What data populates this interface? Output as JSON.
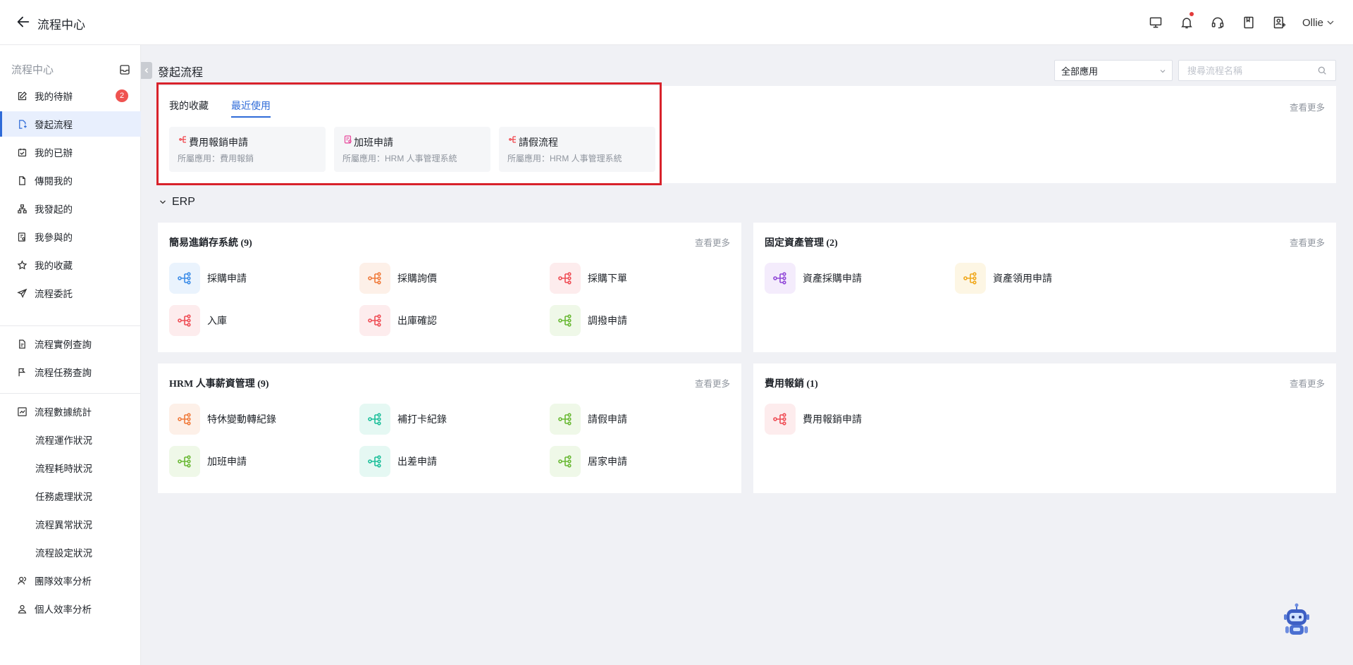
{
  "header": {
    "title": "流程中心",
    "user": "Ollie",
    "icons": [
      "monitor-icon",
      "bell-icon",
      "headset-icon",
      "book-icon",
      "user-card-icon"
    ]
  },
  "sidebar": {
    "title": "流程中心",
    "items": [
      {
        "label": "我的待辦",
        "badge": "2"
      },
      {
        "label": "發起流程"
      },
      {
        "label": "我的已辦"
      },
      {
        "label": "傳閱我的"
      },
      {
        "label": "我發起的"
      },
      {
        "label": "我參與的"
      },
      {
        "label": "我的收藏"
      },
      {
        "label": "流程委託"
      },
      {
        "label": "流程實例查詢"
      },
      {
        "label": "流程任務查詢"
      },
      {
        "label": "流程數據統計"
      },
      {
        "label": "流程運作狀況"
      },
      {
        "label": "流程耗時狀況"
      },
      {
        "label": "任務處理狀況"
      },
      {
        "label": "流程異常狀況"
      },
      {
        "label": "流程設定狀況"
      },
      {
        "label": "團隊效率分析"
      },
      {
        "label": "個人效率分析"
      }
    ]
  },
  "main": {
    "title": "發起流程",
    "app_select": "全部應用",
    "search_placeholder": "搜尋流程名稱",
    "view_more": "查看更多",
    "tabs": [
      "我的收藏",
      "最近使用"
    ],
    "recent": [
      {
        "name": "費用報銷申請",
        "app": "所屬應用：費用報銷",
        "color": "#f0454b"
      },
      {
        "name": "加班申請",
        "app": "所屬應用：HRM 人事管理系統",
        "color": "#e8479a"
      },
      {
        "name": "請假流程",
        "app": "所屬應用：HRM 人事管理系統",
        "color": "#f0454b"
      }
    ],
    "group": "ERP",
    "cards": [
      {
        "title": "簡易進銷存系統 (9)",
        "items": [
          {
            "name": "採購申請",
            "color": "#3d8de8",
            "bg": "#eaf3fd"
          },
          {
            "name": "採購詢價",
            "color": "#f07a3a",
            "bg": "#fdf0e8"
          },
          {
            "name": "採購下單",
            "color": "#ef4d55",
            "bg": "#fdeced"
          },
          {
            "name": "入庫",
            "color": "#ef4d55",
            "bg": "#fdeced"
          },
          {
            "name": "出庫確認",
            "color": "#ef4d55",
            "bg": "#fdeced"
          },
          {
            "name": "調撥申請",
            "color": "#6ab935",
            "bg": "#eff8e8"
          }
        ]
      },
      {
        "title": "固定資產管理 (2)",
        "items": [
          {
            "name": "資產採購申請",
            "color": "#9148d8",
            "bg": "#f4ecfc"
          },
          {
            "name": "資產領用申請",
            "color": "#f0a81c",
            "bg": "#fdf6e4"
          }
        ]
      },
      {
        "title": "HRM 人事薪資管理 (9)",
        "items": [
          {
            "name": "特休變動轉紀錄",
            "color": "#f07a3a",
            "bg": "#fdf0e8"
          },
          {
            "name": "補打卡紀錄",
            "color": "#1cbf9a",
            "bg": "#e5f8f3"
          },
          {
            "name": "請假申請",
            "color": "#6ab935",
            "bg": "#eff8e8"
          },
          {
            "name": "加班申請",
            "color": "#6ab935",
            "bg": "#eff8e8"
          },
          {
            "name": "出差申請",
            "color": "#1cbf9a",
            "bg": "#e5f8f3"
          },
          {
            "name": "居家申請",
            "color": "#6ab935",
            "bg": "#eff8e8"
          }
        ]
      },
      {
        "title": "費用報銷 (1)",
        "items": [
          {
            "name": "費用報銷申請",
            "color": "#ef4d55",
            "bg": "#fdeced"
          }
        ]
      }
    ]
  }
}
